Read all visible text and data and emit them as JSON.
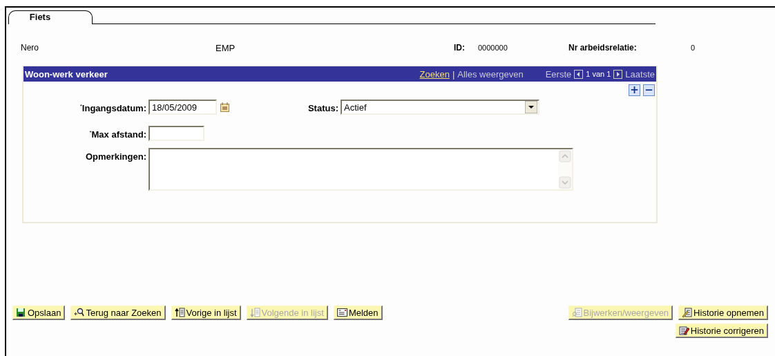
{
  "tabs": [
    {
      "label": "Fiets",
      "selected": true
    }
  ],
  "header": {
    "name": "Nero",
    "type": "EMP",
    "id_label": "ID:",
    "id_value": "0000000",
    "relation_label": "Nr arbeidsrelatie:",
    "relation_value": "0"
  },
  "panel": {
    "title": "Woon-werk verkeer",
    "search_link": "Zoeken",
    "separator": "|",
    "show_all": "Alles weergeven",
    "first": "Eerste",
    "position": "1 van 1",
    "last": "Laatste",
    "row_buttons": [
      {
        "label": "+"
      },
      {
        "label": "−"
      }
    ],
    "date_field": {
      "label": "$^{*}$Ingangsdatum:",
      "value": "18/05/2009"
    },
    "status_field": {
      "label": "Status:",
      "value": "Actief"
    },
    "distance_field": {
      "label": "$^{*}$Max afstand:"
    },
    "remarks_field": {
      "label": "Opmerkingen:"
    }
  },
  "buttons_left": [
    {
      "label": "Opslaan",
      "disabled": false
    },
    {
      "label": "Terug naar Zoeken",
      "disabled": false
    },
    {
      "label": "Vorige in lijst",
      "disabled": false
    },
    {
      "label": "Volgende in lijst",
      "disabled": true
    },
    {
      "label": "Melden",
      "disabled": false
    }
  ],
  "buttons_right": [
    {
      "label": "Bijwerken/weergeven",
      "disabled": true
    },
    {
      "label": "Historie opnemen",
      "disabled": false
    },
    {
      "label": "Historie corrigeren",
      "disabled": false
    }
  ]
}
